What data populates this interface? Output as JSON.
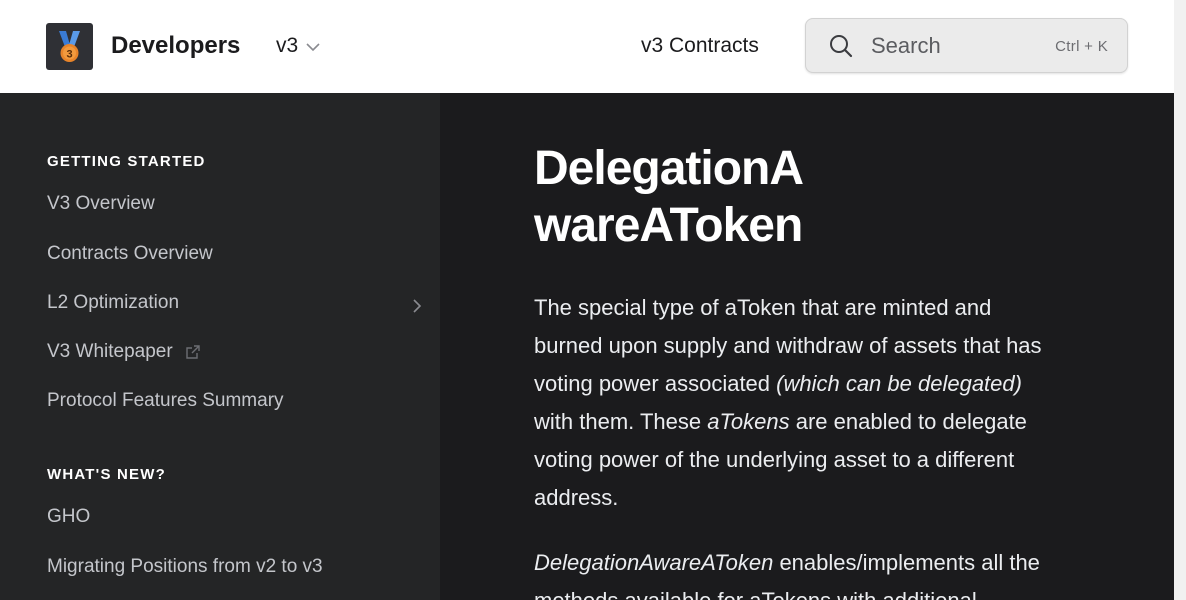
{
  "header": {
    "brand": "Developers",
    "version": "v3",
    "nav_link": "v3 Contracts",
    "search_label": "Search",
    "search_shortcut": "Ctrl + K",
    "logo_badge_number": "3"
  },
  "sidebar": {
    "sections": [
      {
        "title": "GETTING STARTED",
        "items": [
          {
            "label": "V3 Overview"
          },
          {
            "label": "Contracts Overview"
          },
          {
            "label": "L2 Optimization"
          },
          {
            "label": "V3 Whitepaper"
          },
          {
            "label": "Protocol Features Summary"
          }
        ]
      },
      {
        "title": "WHAT'S NEW?",
        "items": [
          {
            "label": "GHO"
          },
          {
            "label": "Migrating Positions from v2 to v3"
          }
        ]
      }
    ]
  },
  "content": {
    "title": "DelegationAwareAToken",
    "p1_a": "The special type of aToken that are minted and burned upon supply and withdraw of assets that has voting power associated ",
    "p1_em1": "(which can be delegated)",
    "p1_b": " with them. These ",
    "p1_em2": "aTokens",
    "p1_c": " are enabled to delegate voting power of the underlying asset to a different address.",
    "p2_em": "DelegationAwareAToken",
    "p2_a": " enables/implements all the methods available for aTokens with additional"
  },
  "colors": {
    "dark_bg": "#1b1b1d",
    "sidebar_bg": "#242526",
    "header_bg": "#ffffff",
    "logo_bg": "#2f3035",
    "medal": "#e8842a",
    "ribbon": "#3a7bd5"
  }
}
